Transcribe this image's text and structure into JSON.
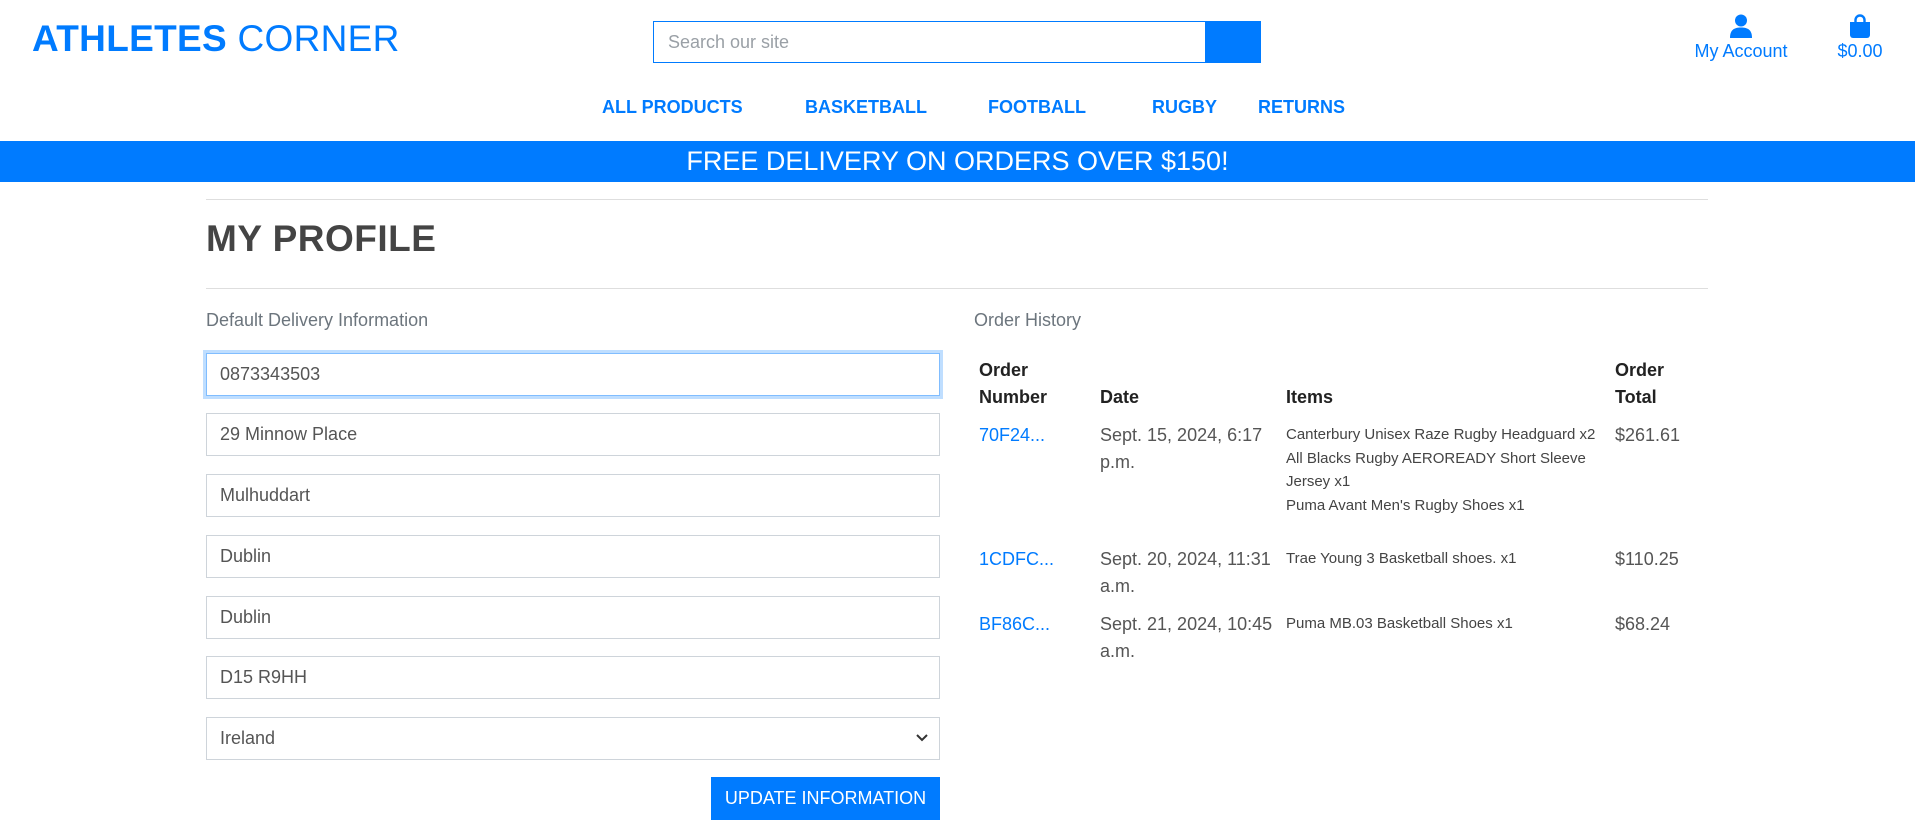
{
  "brand": {
    "part1": "ATHLETES",
    "part2": "CORNER"
  },
  "search": {
    "placeholder": "Search our site"
  },
  "account": {
    "label": "My Account"
  },
  "cart": {
    "total": "$0.00"
  },
  "nav": [
    "ALL PRODUCTS",
    "BASKETBALL",
    "FOOTBALL",
    "RUGBY",
    "RETURNS"
  ],
  "banner": "FREE DELIVERY ON ORDERS OVER $150!",
  "page_title": "MY PROFILE",
  "delivery": {
    "label": "Default Delivery Information",
    "phone": "0873343503",
    "street": "29 Minnow Place",
    "town": "Mulhuddart",
    "county": "Dublin",
    "city": "Dublin",
    "postcode": "D15 R9HH",
    "country": "Ireland",
    "update_label": "UPDATE INFORMATION"
  },
  "orders": {
    "label": "Order History",
    "headers": {
      "number_1": "Order",
      "number_2": "Number",
      "date": "Date",
      "items": "Items",
      "total_1": "Order",
      "total_2": "Total"
    },
    "rows": [
      {
        "number": "70F24...",
        "date_1": "Sept. 15, 2024, 6:17",
        "date_2": "p.m.",
        "item_lines": [
          "Canterbury Unisex Raze Rugby Headguard x2",
          "All Blacks Rugby AEROREADY Short Sleeve",
          "Jersey x1",
          "Puma Avant Men's Rugby Shoes x1"
        ],
        "total": "$261.61"
      },
      {
        "number": "1CDFC...",
        "date_1": "Sept. 20, 2024, 11:31",
        "date_2": "a.m.",
        "item_lines": [
          "Trae Young 3 Basketball shoes. x1"
        ],
        "total": "$110.25"
      },
      {
        "number": "BF86C...",
        "date_1": "Sept. 21, 2024, 10:45",
        "date_2": "a.m.",
        "item_lines": [
          "Puma MB.03 Basketball Shoes x1"
        ],
        "total": "$68.24"
      }
    ]
  },
  "colors": {
    "accent": "#007bff",
    "text": "#555555",
    "muted": "#6c757d",
    "border": "#ced4da"
  },
  "icons": {
    "account": "user-icon",
    "cart": "shopping-bag-icon",
    "select": "chevron-down-icon"
  }
}
